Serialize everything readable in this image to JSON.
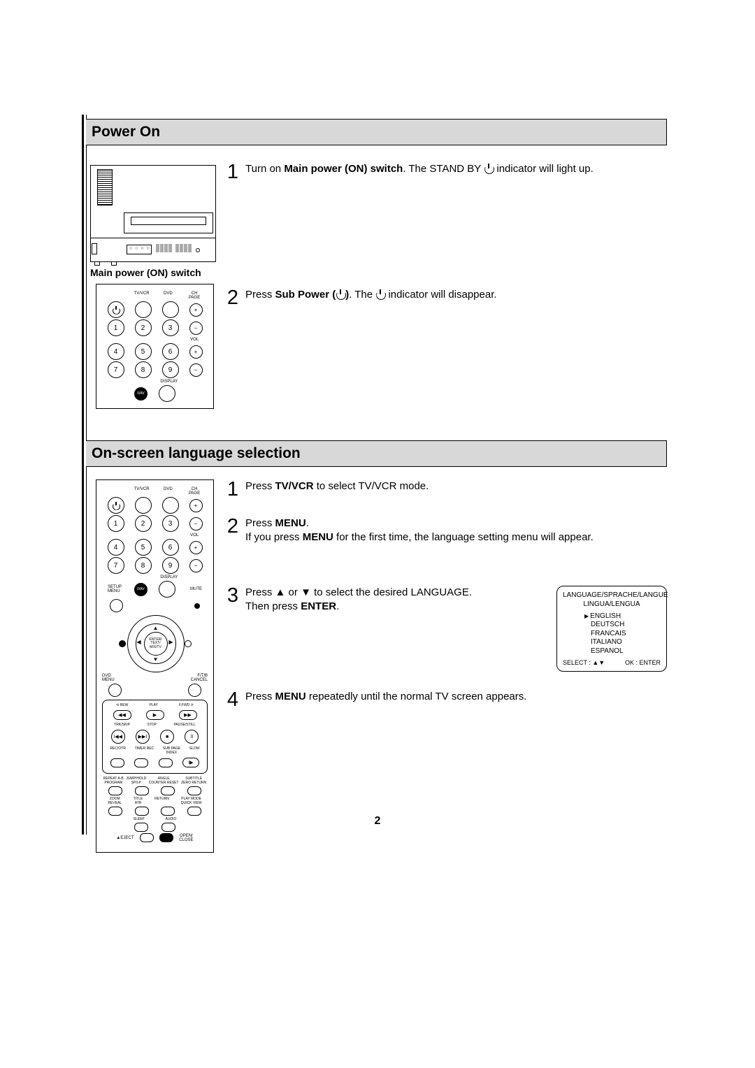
{
  "page_number": "2",
  "section1": {
    "title": "Power On",
    "tv_caption": "Main power (ON) switch",
    "step1_a": "Turn on ",
    "step1_b": "Main power (ON) switch",
    "step1_c": ". The STAND BY ",
    "step1_d": " indicator will light up.",
    "step2_a": "Press ",
    "step2_b": "Sub Power (",
    "step2_c": ")",
    "step2_d": ". The ",
    "step2_e": " indicator will disappear."
  },
  "section2": {
    "title": "On-screen language selection",
    "step1_a": "Press ",
    "step1_b": "TV/VCR",
    "step1_c": " to select TV/VCR mode.",
    "step2_a": "Press ",
    "step2_b": "MENU",
    "step2_c": ".",
    "step2_d": "If you press ",
    "step2_e": "MENU",
    "step2_f": " for the first time, the language setting menu will appear.",
    "step3_a": "Press ",
    "step3_up": "▲",
    "step3_or": " or ",
    "step3_down": "▼",
    "step3_b": " to select the desired LANGUAGE.",
    "step3_c": "Then press ",
    "step3_d": "ENTER",
    "step3_e": ".",
    "step4_a": "Press ",
    "step4_b": "MENU",
    "step4_c": " repeatedly until the normal TV screen appears."
  },
  "osd": {
    "title1": "LANGUAGE/SPRACHE/LANGUE",
    "title2": "LINGUA/LENGUA",
    "opt1": "ENGLISH",
    "opt2": "DEUTSCH",
    "opt3": "FRANCAIS",
    "opt4": "ITALIANO",
    "opt5": "ESPANOL",
    "select": "SELECT : ▲▼",
    "ok": "OK : ENTER"
  },
  "remote": {
    "top_labels": {
      "tvvcr": "TV/VCR",
      "dvd": "DVD",
      "ch_page": "CH\nPAGE"
    },
    "nums": [
      "1",
      "2",
      "3",
      "4",
      "5",
      "6",
      "7",
      "8",
      "9"
    ],
    "vol": "VOL",
    "display": "DISPLAY",
    "zero_av": "0/AV",
    "setup_menu": "SETUP\nMENU",
    "mute": "MUTE",
    "enter": "ENTER/\nTEXT/\nMIX/TV",
    "dvd_menu": "DVD MENU",
    "fytb": "F/T/B\nCANCEL",
    "rew": "REW",
    "play": "PLAY",
    "ffwd": "F.FWD",
    "trkskip": "TRK/SKIP",
    "stop": "STOP",
    "pausestill": "PAUSE/STILL",
    "recotr": "REC/OTR",
    "timerrec": "TIMER REC",
    "subpage": "SUB PAGE\nINDEX",
    "slow": "SLOW",
    "r1a": "REPEAT A-B\nPROGRAM",
    "r1b": "JUMP/HOLD\nSP/LP",
    "r1c": "ANGLE\nCOUNTER RESET",
    "r1d": "SUBTITLE\nZERO RETURN",
    "r2a": "ZOOM\nREVEAL",
    "r2b": "TITLE\nATR",
    "r2c": "RETURN",
    "r2d": "PLAY MODE\nQUICK VIEW",
    "sleep": "SLEEP",
    "audio": "AUDIO",
    "eject": "▲EJECT",
    "open": "OPEN/\nCLOSE"
  }
}
